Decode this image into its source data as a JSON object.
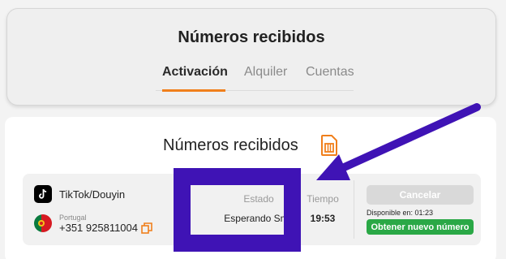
{
  "header": {
    "title": "Números recibidos",
    "tabs": [
      {
        "label": "Activación",
        "active": true
      },
      {
        "label": "Alquiler",
        "active": false
      },
      {
        "label": "Cuentas",
        "active": false
      }
    ],
    "accent_color": "#f07f1b"
  },
  "main": {
    "title": "Números recibidos",
    "row": {
      "service": "TikTok/Douyin",
      "country": "Portugal",
      "phone": "+351 925811004",
      "status_label": "Estado",
      "status_value": "Esperando Sms",
      "time_label": "Tiempo",
      "time_value": "19:53",
      "cancel_label": "Cancelar",
      "available_text": "Disponible en: 01:23",
      "new_number_label": "Obtener nuevo número"
    }
  },
  "icons": {
    "sim": "sim-card-icon",
    "service": "tiktok-icon",
    "flag": "portugal-flag-icon",
    "copy": "copy-icon"
  },
  "colors": {
    "highlight": "#3f13b5",
    "new_button": "#2aa846",
    "cancel_button": "#d9d9d9"
  }
}
